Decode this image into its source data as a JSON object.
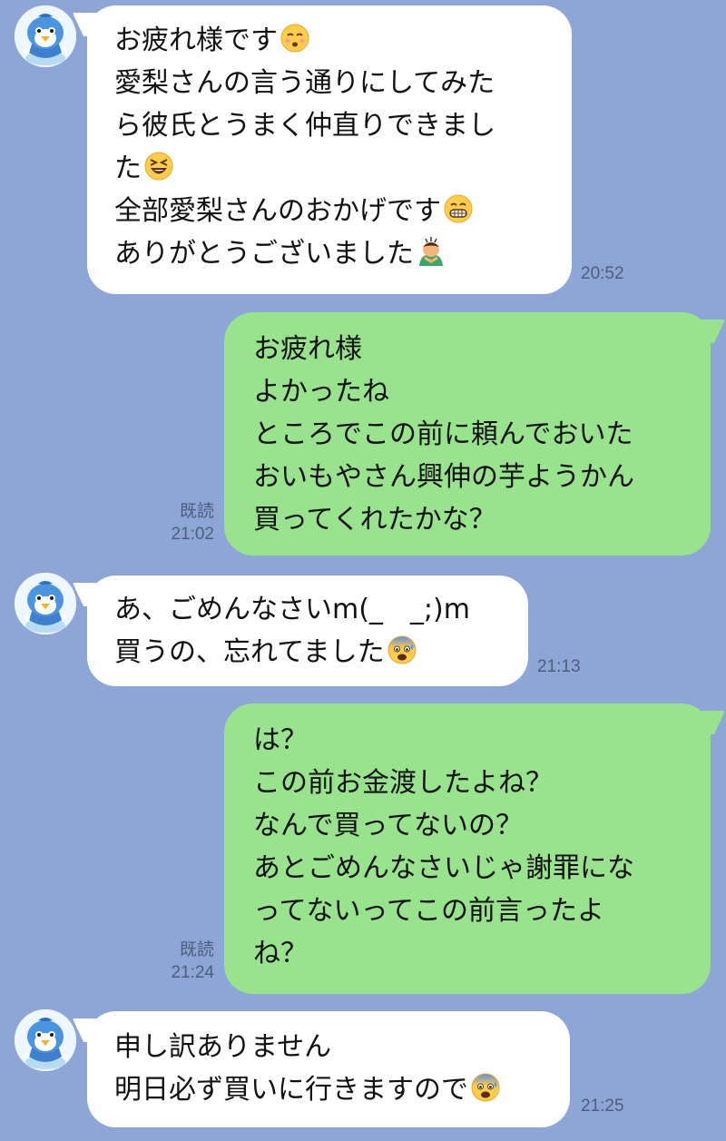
{
  "messages": [
    {
      "side": "in",
      "lines": [
        "お疲れ様です",
        "愛梨さんの言う通りにしてみた",
        "ら彼氏とうまく仲直りできまし",
        "た",
        "全部愛梨さんのおかげです",
        "ありがとうございました"
      ],
      "time": "20:52"
    },
    {
      "side": "out",
      "lines": [
        "お疲れ様",
        "よかったね",
        "ところでこの前に頼んでおいた",
        "おいもやさん興伸の芋ようかん",
        "買ってくれたかな？"
      ],
      "read": "既読",
      "time": "21:02"
    },
    {
      "side": "in",
      "lines": [
        "あ、ごめんなさいm(_　_;)m",
        "買うの、忘れてました"
      ],
      "time": "21:13"
    },
    {
      "side": "out",
      "lines": [
        "は？",
        "この前お金渡したよね？",
        "なんで買ってないの？",
        "あとごめんなさいじゃ謝罪にな",
        "ってないってこの前言ったよ",
        "ね？"
      ],
      "read": "既読",
      "time": "21:24"
    },
    {
      "side": "in",
      "lines": [
        "申し訳ありません",
        "明日必ず買いに行きますので"
      ],
      "time": "21:25"
    }
  ],
  "icons": {
    "avatar": "penguin-avatar-icon",
    "emoji": [
      "kissing-emoji-icon",
      "laughing-emoji-icon",
      "grinning-emoji-icon",
      "person-bowing-emoji-icon",
      "anxious-sweat-emoji-icon",
      "fearful-emoji-icon"
    ]
  },
  "colors": {
    "background": "#8ea6d6",
    "incoming_bubble": "#ffffff",
    "outgoing_bubble": "#99e28e",
    "meta_text": "#4d5d7d"
  }
}
